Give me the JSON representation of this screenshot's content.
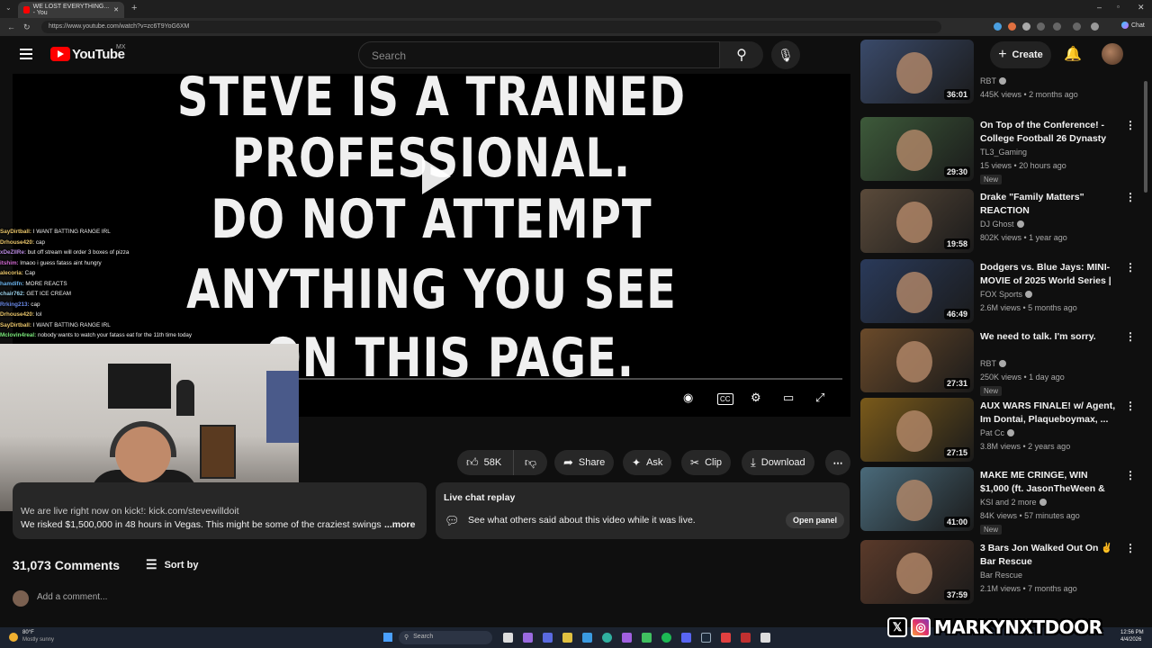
{
  "browser": {
    "tab_title": "WE LOST EVERYTHING... - You",
    "url": "https://www.youtube.com/watch?v=zc6T9YoG6XM",
    "chat_button": "Chat"
  },
  "header": {
    "logo_text": "YouTube",
    "country": "MX",
    "search_placeholder": "Search",
    "create_label": "Create"
  },
  "video": {
    "lines": [
      "STEVE IS A TRAINED",
      "PROFESSIONAL.",
      "DO NOT ATTEMPT",
      "ANYTHING YOU SEE",
      "ON THIS PAGE."
    ]
  },
  "chat": {
    "messages": [
      {
        "user": "SayDirtball:",
        "text": "I WANT BATTING RANGE IRL",
        "color": "#e9c56a"
      },
      {
        "user": "Drhouse420:",
        "text": "cap",
        "color": "#e9c56a"
      },
      {
        "user": "xDeZIIRe:",
        "text": "but off stream will order 3 boxes of pizza",
        "color": "#b98ae0"
      },
      {
        "user": "itshim:",
        "text": "lmaoo i guess fatass aint hungry",
        "color": "#d36ad3"
      },
      {
        "user": "alecoria:",
        "text": "Cap",
        "color": "#e9c56a"
      },
      {
        "user": "hamdifn:",
        "text": "MORE REACTS",
        "color": "#6ab0e9"
      },
      {
        "user": "chair762:",
        "text": "GET ICE CREAM",
        "color": "#9ad0e9"
      },
      {
        "user": "Rrking213:",
        "text": "cap",
        "color": "#6a8ae9"
      },
      {
        "user": "Drhouse420:",
        "text": "lol",
        "color": "#e9c56a"
      },
      {
        "user": "SayDirtball:",
        "text": "I WANT BATTING RANGE IRL",
        "color": "#e9c56a"
      },
      {
        "user": "Mclovin4real:",
        "text": "nobody wants to watch your fatass eat for the 11th time today",
        "color": "#7ae97a"
      }
    ]
  },
  "actions": {
    "likes": "58K",
    "share": "Share",
    "ask": "Ask",
    "clip": "Clip",
    "download": "Download"
  },
  "description": {
    "line1": "We are live right now on kick!: kick.com/stevewilldoit",
    "line2": "We risked $1,500,000 in 48 hours in Vegas. This might be some of the craziest swings",
    "more": "...more"
  },
  "live_chat": {
    "title": "Live chat replay",
    "text": "See what others said about this video while it was live.",
    "button": "Open panel"
  },
  "comments": {
    "count": "31,073 Comments",
    "sort": "Sort by",
    "placeholder": "Add a comment..."
  },
  "sidebar": [
    {
      "title": "",
      "channel": "RBT",
      "verified": true,
      "meta": "445K views • 2 months ago",
      "duration": "36:01",
      "new": "",
      "thumb": "#3a4a6a"
    },
    {
      "title": "On Top of the Conference! - College Football 26 Dynasty E...",
      "channel": "TL3_Gaming",
      "verified": false,
      "meta": "15 views • 20 hours ago",
      "duration": "29:30",
      "new": "New",
      "thumb": "#3d5a3a"
    },
    {
      "title": "Drake \"Family Matters\" REACTION",
      "channel": "DJ Ghost",
      "verified": true,
      "meta": "802K views • 1 year ago",
      "duration": "19:58",
      "new": "",
      "thumb": "#5a4a3a"
    },
    {
      "title": "Dodgers vs. Blue Jays: MINI-MOVIE of 2025 World Series | ...",
      "channel": "FOX Sports",
      "verified": true,
      "meta": "2.6M views • 5 months ago",
      "duration": "46:49",
      "new": "",
      "thumb": "#2a3a5a"
    },
    {
      "title": "We need to talk. I'm sorry.",
      "channel": "RBT",
      "verified": true,
      "meta": "250K views • 1 day ago",
      "duration": "27:31",
      "new": "New",
      "thumb": "#6a4a2a"
    },
    {
      "title": "AUX WARS FINALE! w/ Agent, Im Dontai, Plaqueboymax, ...",
      "channel": "Pat Cc",
      "verified": true,
      "meta": "3.8M views • 2 years ago",
      "duration": "27:15",
      "new": "",
      "thumb": "#7a5a1a"
    },
    {
      "title": "MAKE ME CRINGE, WIN $1,000 (ft. JasonTheWeen & Jack ...",
      "channel": "KSI and 2 more",
      "verified": true,
      "meta": "84K views • 57 minutes ago",
      "duration": "41:00",
      "new": "New",
      "thumb": "#4a6a7a"
    },
    {
      "title": "3 Bars Jon Walked Out On ✌ Bar Rescue",
      "channel": "Bar Rescue",
      "verified": false,
      "meta": "2.1M views • 7 months ago",
      "duration": "37:59",
      "new": "",
      "thumb": "#5a3a2a"
    }
  ],
  "watermark": {
    "name": "MARKYNXTDOOR"
  },
  "taskbar": {
    "weather_temp": "80°F",
    "weather_desc": "Mostly sunny",
    "search": "Search",
    "time": "12:56 PM",
    "date": "4/4/2026"
  }
}
